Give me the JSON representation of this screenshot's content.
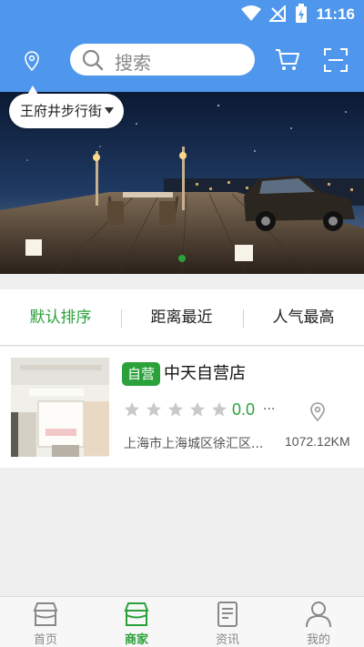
{
  "status_bar": {
    "time": "11:16"
  },
  "header": {
    "location_icon": "location-pin-icon",
    "search_placeholder": "搜索",
    "cart_icon": "cart-icon",
    "scan_icon": "scan-icon"
  },
  "banner": {
    "city": "王府井步行街",
    "carousel_active_index": 1
  },
  "sort_tabs": [
    {
      "label": "默认排序",
      "active": true
    },
    {
      "label": "距离最近",
      "active": false
    },
    {
      "label": "人气最高",
      "active": false
    }
  ],
  "shop": {
    "badge": "自营",
    "name": "中天自营店",
    "stars_filled": 0,
    "stars_total": 5,
    "rating": "0.0",
    "rating_more": "...",
    "address": "上海市上海城区徐汇区...",
    "distance": "1072.12KM"
  },
  "bottom_nav": [
    {
      "label": "首页",
      "icon": "home-store-icon",
      "active": false
    },
    {
      "label": "商家",
      "icon": "merchant-icon",
      "active": true
    },
    {
      "label": "资讯",
      "icon": "news-icon",
      "active": false
    },
    {
      "label": "我的",
      "icon": "profile-icon",
      "active": false
    }
  ],
  "colors": {
    "primary": "#4f97ec",
    "accent_green": "#2aa13a"
  }
}
